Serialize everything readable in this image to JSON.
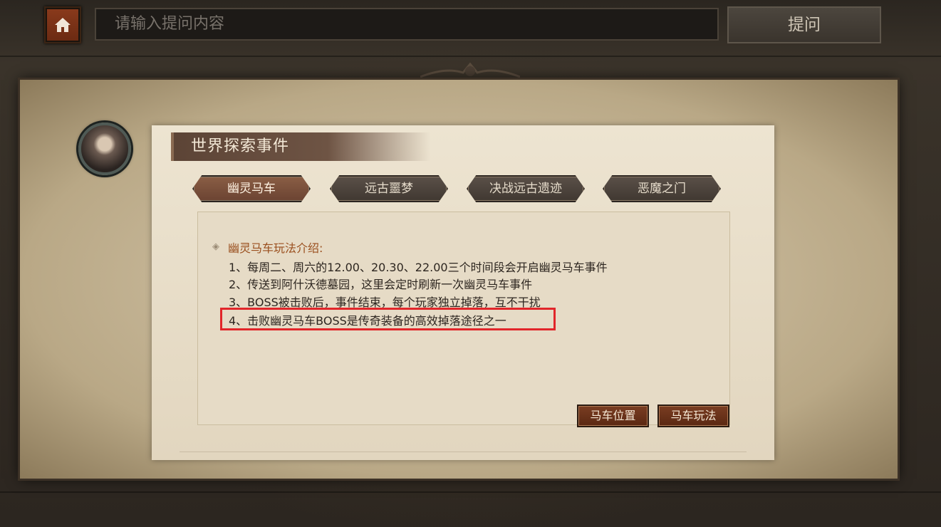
{
  "topbar": {
    "search_placeholder": "请输入提问内容",
    "ask_label": "提问"
  },
  "panel": {
    "title": "世界探索事件",
    "tabs": [
      {
        "label": "幽灵马车",
        "active": true
      },
      {
        "label": "远古噩梦",
        "active": false
      },
      {
        "label": "决战远古遗迹",
        "active": false
      },
      {
        "label": "恶魔之门",
        "active": false
      }
    ],
    "intro_title": "幽灵马车玩法介绍:",
    "lines": [
      "1、每周二、周六的12.00、20.30、22.00三个时间段会开启幽灵马车事件",
      "2、传送到阿什沃德墓园，这里会定时刷新一次幽灵马车事件",
      "3、BOSS被击败后，事件结束，每个玩家独立掉落，互不干扰",
      "4、击败幽灵马车BOSS是传奇装备的高效掉落途径之一"
    ],
    "buttons": {
      "location": "马车位置",
      "gameplay": "马车玩法"
    }
  },
  "colors": {
    "accent_orange": "#9a4f1e",
    "highlight_red": "#e1262a",
    "button_brown": "#6b3219"
  },
  "icons": [
    "home-icon",
    "avatar-portrait",
    "diamond-bullet-icon"
  ]
}
